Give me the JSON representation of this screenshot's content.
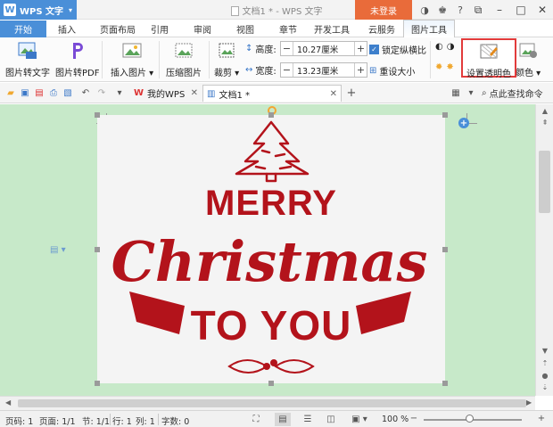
{
  "titlebar": {
    "app_name": "WPS 文字",
    "doc_title": "文档1 * - WPS 文字",
    "login": "未登录",
    "icons": [
      "skin-icon",
      "shirt-icon",
      "help-icon",
      "menu-icon"
    ]
  },
  "tabs": [
    "开始",
    "插入",
    "页面布局",
    "引用",
    "审阅",
    "视图",
    "章节",
    "开发工具",
    "云服务",
    "图片工具"
  ],
  "ribbon": {
    "pic_to_text": "图片转文字",
    "pic_to_pdf": "图片转PDF",
    "insert_picture": "插入图片",
    "compress_picture": "压缩图片",
    "crop": "裁剪",
    "height_label": "高度:",
    "height_value": "10.27厘米",
    "width_label": "宽度:",
    "width_value": "13.23厘米",
    "lock_ratio": "锁定纵横比",
    "reset_size": "重设大小",
    "set_transparent": "设置透明色",
    "color": "颜色"
  },
  "quickbar": {
    "tab_mywps": "我的WPS",
    "tab_doc1": "文档1 *",
    "search_cmd": "点此查找命令"
  },
  "image": {
    "line1": "MERRY",
    "line2": "Christmas",
    "line3": "TO YOU",
    "ink_color": "#b3131b"
  },
  "status": {
    "page_num": "页码: 1",
    "pages": "页面: 1/1",
    "section": "节: 1/1",
    "row": "行: 1",
    "col": "列: 1",
    "word_count": "字数: 0",
    "zoom": "100 %"
  }
}
